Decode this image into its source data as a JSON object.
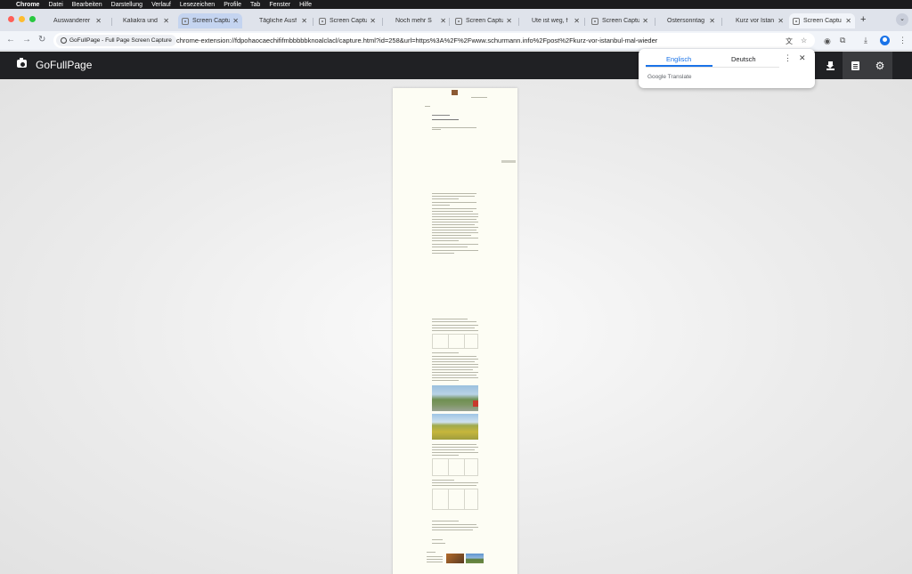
{
  "menubar": {
    "app": "Chrome",
    "items": [
      "Datei",
      "Bearbeiten",
      "Darstellung",
      "Verlauf",
      "Lesezeichen",
      "Profile",
      "Tab",
      "Fenster",
      "Hilfe"
    ]
  },
  "tabs": [
    {
      "title": "Auswanderer"
    },
    {
      "title": "Kaliakra und"
    },
    {
      "title": "Screen Captu"
    },
    {
      "title": "Tägliche Ausf"
    },
    {
      "title": "Screen Captu"
    },
    {
      "title": "Noch mehr S"
    },
    {
      "title": "Screen Captu"
    },
    {
      "title": "Ute ist weg, f"
    },
    {
      "title": "Screen Captu"
    },
    {
      "title": "Ostersonntag"
    },
    {
      "title": "Kurz vor Istan"
    },
    {
      "title": "Screen Captu"
    }
  ],
  "toolbar": {
    "site_chip": "GoFullPage - Full Page Screen Capture",
    "url": "chrome-extension://fdpohaocaechififmbbbbbknoalclacl/capture.html?id=258&url=https%3A%2F%2Fwww.schurmann.info%2Fpost%2Fkurz-vor-istanbul-mal-wieder"
  },
  "app": {
    "title": "GoFullPage"
  },
  "translate": {
    "source_lang": "Englisch",
    "target_lang": "Deutsch",
    "brand": "Google Translate"
  },
  "colors": {
    "accent": "#1a73e8",
    "header_bg": "#202124",
    "close_red": "#ff5f57",
    "minimize_yellow": "#febc2e",
    "zoom_green": "#28c840"
  }
}
